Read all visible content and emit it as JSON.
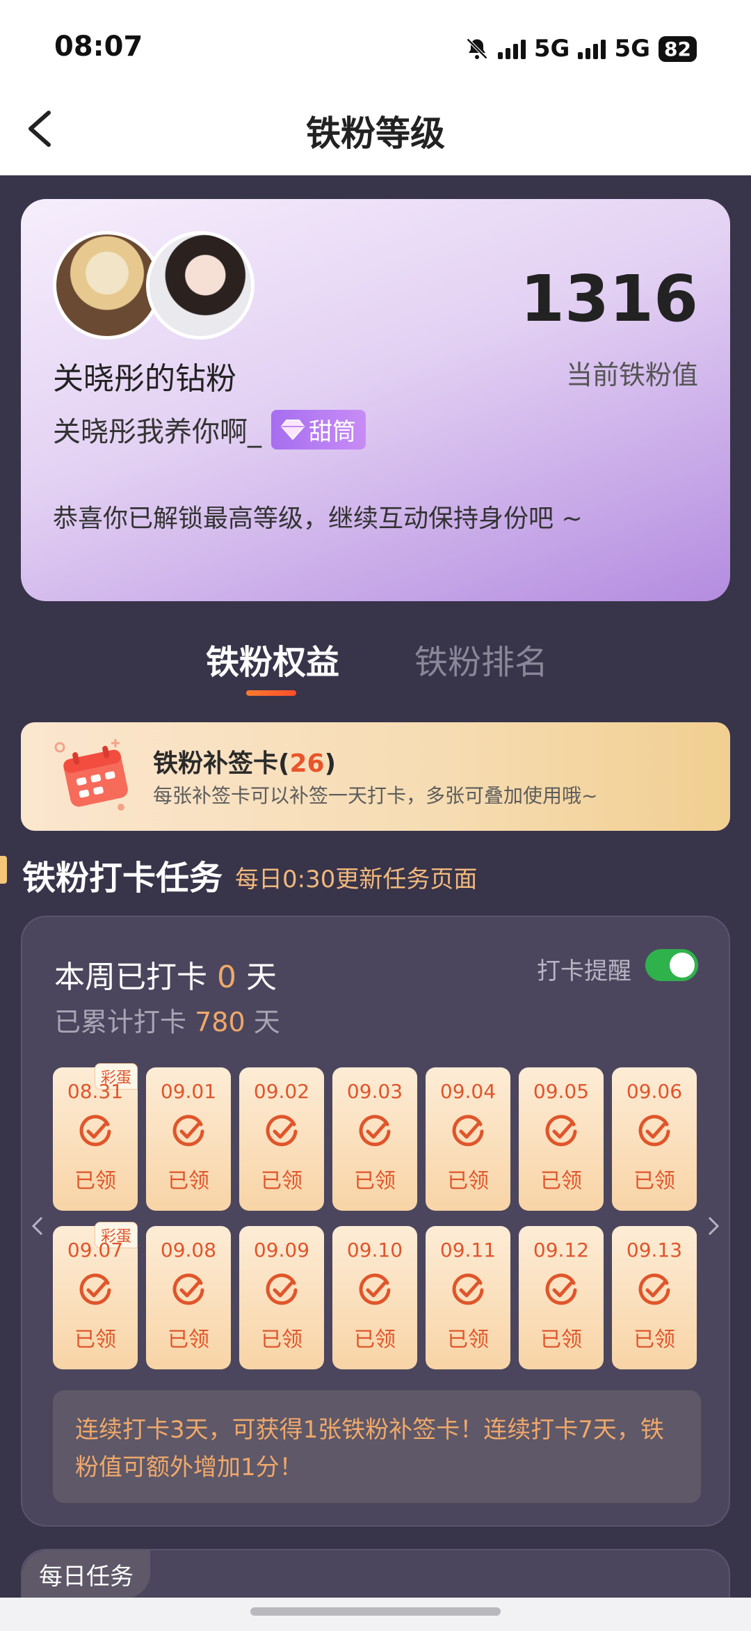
{
  "status_bar": {
    "time": "08:07",
    "network1": "5G",
    "network2": "5G",
    "battery": "82",
    "icons": [
      "bell-muted-icon",
      "signal-icon",
      "signal-icon",
      "battery-icon"
    ]
  },
  "header": {
    "title": "铁粉等级",
    "back_icon": "chevron-left-icon"
  },
  "hero": {
    "fan_name": "关晓彤的钻粉",
    "user_name": "关晓彤我养你啊_",
    "badge_label": "甜筒",
    "message": "恭喜你已解锁最高等级，继续互动保持身份吧 ~",
    "score": "1316",
    "score_label": "当前铁粉值"
  },
  "tabs": [
    {
      "label": "铁粉权益",
      "active": true
    },
    {
      "label": "铁粉排名",
      "active": false
    }
  ],
  "supplement": {
    "title": "铁粉补签卡(",
    "count": "26",
    "title_end": ")",
    "desc": "每张补签卡可以补签一天打卡，多张可叠加使用哦~"
  },
  "section": {
    "title": "铁粉打卡任务",
    "subtitle": "每日0:30更新任务页面"
  },
  "checkin": {
    "week_prefix": "本周已打卡 ",
    "week_count": "0",
    "week_suffix": " 天",
    "total_prefix": "已累计打卡 ",
    "total_count": "780",
    "total_suffix": " 天",
    "remind_label": "打卡提醒",
    "remind_on": true,
    "egg_label": "彩蛋",
    "status_label": "已领",
    "row1": [
      "08.31",
      "09.01",
      "09.02",
      "09.03",
      "09.04",
      "09.05",
      "09.06"
    ],
    "row2": [
      "09.07",
      "09.08",
      "09.09",
      "09.10",
      "09.11",
      "09.12",
      "09.13"
    ],
    "tip": "连续打卡3天，可获得1张铁粉补签卡！连续打卡7天，铁粉值可额外增加1分！"
  },
  "daily": {
    "label": "每日任务"
  },
  "colors": {
    "background": "#38344a",
    "accent_orange": "#e0552b",
    "highlight": "#f0a86a",
    "toggle_on": "#2fb24c"
  }
}
